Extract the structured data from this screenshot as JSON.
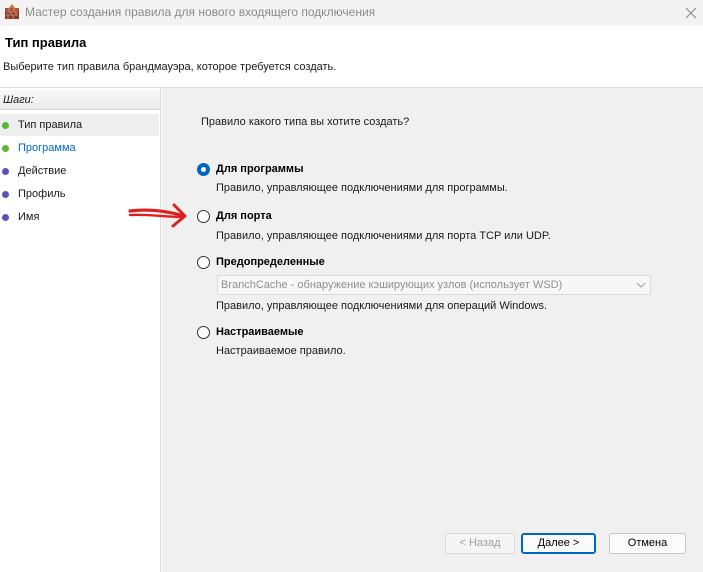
{
  "window": {
    "title": "Мастер создания правила для нового входящего подключения",
    "icon": "firewall-icon",
    "close_icon": "close-icon"
  },
  "header": {
    "title": "Тип правила",
    "description": "Выберите тип правила брандмауэра, которое требуется создать."
  },
  "steps": {
    "header": "Шаги:",
    "items": [
      {
        "label": "Тип правила",
        "dot_color": "#5cb82e",
        "active": true,
        "link": false
      },
      {
        "label": "Программа",
        "dot_color": "#5cb82e",
        "active": false,
        "link": true
      },
      {
        "label": "Действие",
        "dot_color": "#5a52b8",
        "active": false,
        "link": false
      },
      {
        "label": "Профиль",
        "dot_color": "#5a52b8",
        "active": false,
        "link": false
      },
      {
        "label": "Имя",
        "dot_color": "#5a52b8",
        "active": false,
        "link": false
      }
    ]
  },
  "main": {
    "question": "Правило какого типа вы хотите создать?",
    "options": [
      {
        "label": "Для программы",
        "description": "Правило, управляющее подключениями для программы.",
        "checked": true
      },
      {
        "label": "Для порта",
        "description": "Правило, управляющее подключениями для порта TCP или UDP.",
        "checked": false
      },
      {
        "label": "Предопределенные",
        "description": "Правило, управляющее подключениями для операций Windows.",
        "checked": false
      },
      {
        "label": "Настраиваемые",
        "description": "Настраиваемое правило.",
        "checked": false
      }
    ],
    "predefined_select": {
      "value": "BranchCache - обнаружение кэширующих узлов (использует WSD)",
      "enabled": false
    }
  },
  "buttons": {
    "back": "< Назад",
    "next": "Далее >",
    "cancel": "Отмена"
  },
  "colors": {
    "accent": "#0067c0",
    "annotation": "#e02020",
    "link": "#0066cc"
  }
}
